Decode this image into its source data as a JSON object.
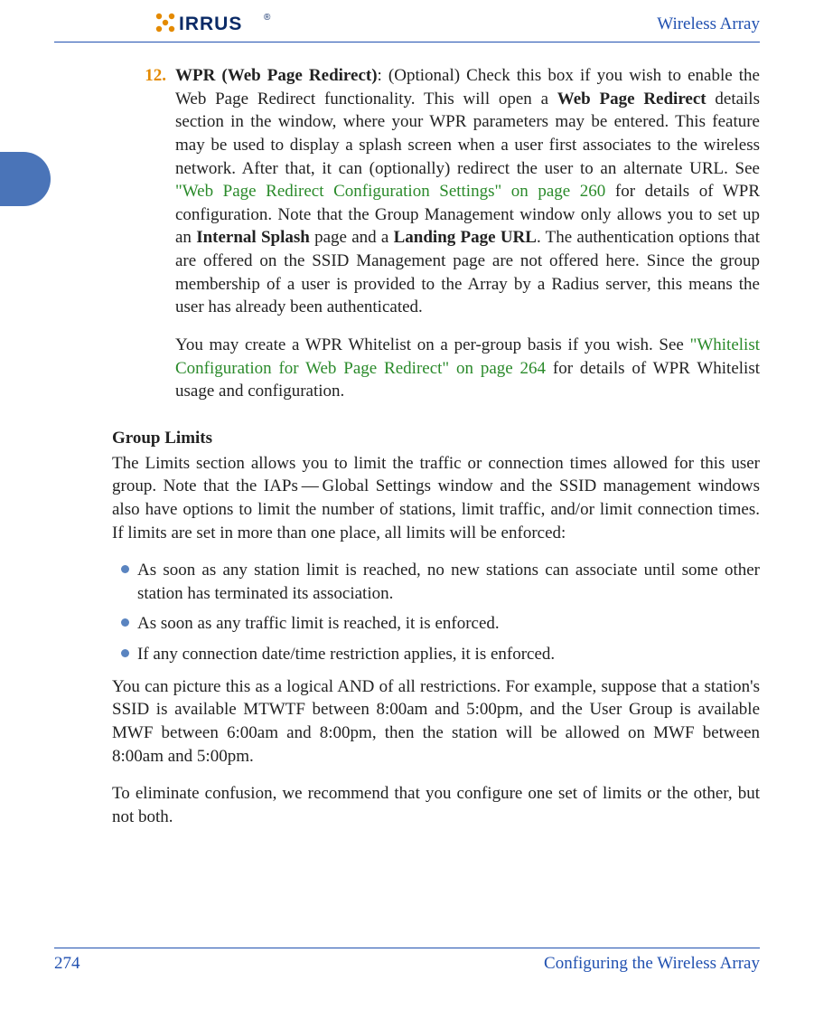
{
  "header": {
    "logo_text_1": "X",
    "logo_text_2": "IRRUS",
    "doc_title": "Wireless Array"
  },
  "item": {
    "number": "12.",
    "title": "WPR (Web Page Redirect)",
    "p1_a": ": (Optional) Check this box if you wish to enable the Web Page Redirect functionality. This will open a ",
    "p1_b_bold": "Web Page Redirect",
    "p1_c": " details section in the window, where your WPR parameters may be entered. This feature may be used to display a splash screen when a user first associates to the wireless network. After that, it can (optionally) redirect the user to an alternate URL. See ",
    "p1_link1": "\"Web Page Redirect Configuration Settings\" on page 260",
    "p1_d": " for details of WPR configuration. Note that the Group Management window only allows you to set up an ",
    "p1_e_bold": "Internal Splash",
    "p1_f": " page and a ",
    "p1_g_bold": "Landing Page URL",
    "p1_h": ". The authentication options that are offered on the SSID Management page are not offered here. Since the group membership of a user is provided to the Array by a Radius server, this means the user has already been authenticated.",
    "p2_a": "You may create a WPR Whitelist on a per-group basis if you wish. See ",
    "p2_link": "\"Whitelist Configuration for Web Page Redirect\" on page 264",
    "p2_b": " for details of WPR Whitelist usage and configuration."
  },
  "section": {
    "heading": "Group Limits",
    "intro": "The Limits section allows you to limit the traffic or connection times allowed for this user group. Note that the IAPs — Global Settings window and the SSID management windows also have options to limit the number of stations, limit traffic, and/or limit connection times. If limits are set in more than one place, all limits will be enforced:",
    "bullets": [
      "As soon as any station limit is reached, no new stations can associate until some other station has terminated its association.",
      "As soon as any traffic limit is reached, it is enforced.",
      "If any connection date/time restriction applies, it is enforced."
    ],
    "after_a": "You can picture this as a logical AND of all restrictions. For example, suppose that a station's SSID is available MTWTF between 8:00am and 5:00pm, and the User Group is available MWF between 6:00am and 8:00pm, then the station will be allowed on MWF between 8:00am and 5:00pm.",
    "after_b": "To eliminate confusion, we recommend that you configure one set of limits or the other, but not both."
  },
  "footer": {
    "page_number": "274",
    "section_title": "Configuring the Wireless Array"
  }
}
